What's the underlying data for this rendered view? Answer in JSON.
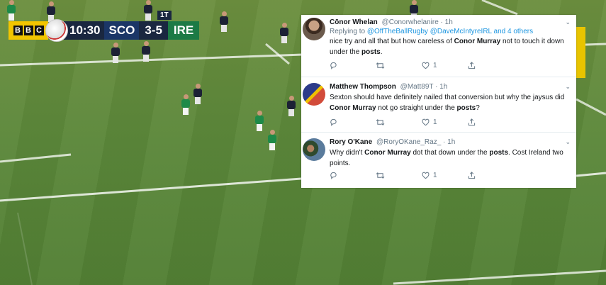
{
  "scorebug": {
    "broadcaster": [
      "B",
      "B",
      "C"
    ],
    "clock": "10:30",
    "home_team": "SCO",
    "score": "3-5",
    "away_team": "IRE",
    "phase_badge": "1T",
    "colors": {
      "bbc_yellow": "#f2c500",
      "home": "#1b3667",
      "away": "#1c7a45",
      "dark": "#1a2740"
    }
  },
  "tweets": [
    {
      "name": "Cōnor Whelan",
      "handle": "@Conorwhelanire",
      "time": "· 1h",
      "replying_prefix": "Replying to",
      "replying_to_1": "@OffTheBallRugby",
      "replying_to_2": "@DaveMcIntyreIRL",
      "replying_others": "and 4 others",
      "text_1": "nice try and all that but how careless of",
      "bold_1": "Conor Murray",
      "text_2": "not to touch it down under the",
      "bold_2": "posts",
      "text_3": ".",
      "like_count": "1"
    },
    {
      "name": "Matthew Thompson",
      "handle": "@Matt89T",
      "time": "· 1h",
      "text_1": "Sexton should have definitely nailed that conversion but why the jaysus did",
      "bold_1": "Conor Murray",
      "text_2": "not go straight under the",
      "bold_2": "posts",
      "text_3": "?",
      "like_count": "1"
    },
    {
      "name": "Rory O'Kane",
      "handle": "@RoryOKane_Raz_",
      "time": "· 1h",
      "text_1": "Why didn't",
      "bold_1": "Conor Murray",
      "text_2": "dot that down under the",
      "bold_2": "posts",
      "text_3": ". Cost Ireland two points.",
      "like_count": "1"
    }
  ],
  "icons": [
    "reply-icon",
    "retweet-icon",
    "like-icon",
    "share-icon",
    "chevron-down-icon"
  ],
  "colors": {
    "link": "#1b95e0",
    "muted": "#657786",
    "text": "#14171a"
  }
}
